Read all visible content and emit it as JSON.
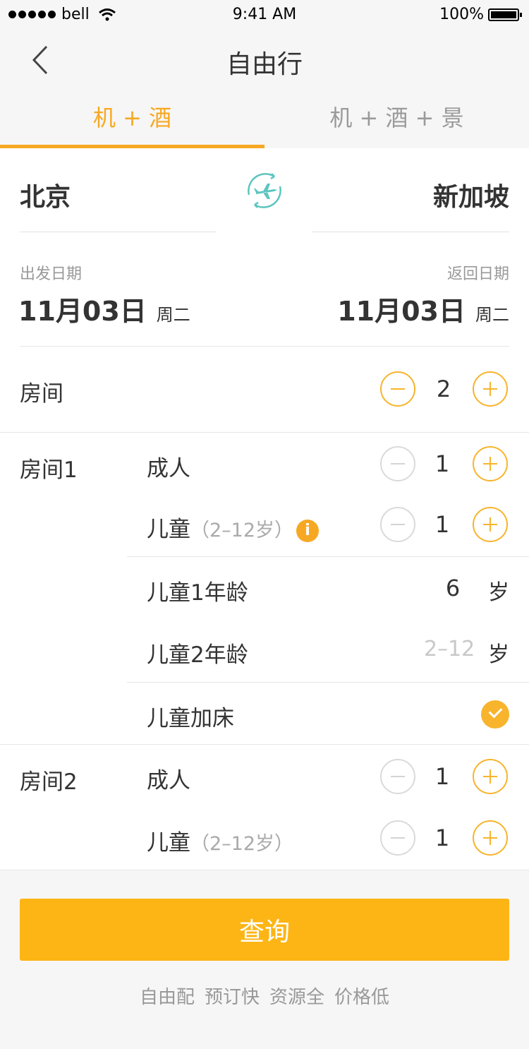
{
  "status": {
    "carrier": "bell",
    "time": "9:41 AM",
    "battery": "100%"
  },
  "nav": {
    "title": "自由行"
  },
  "tabs": [
    {
      "label": "机 + 酒",
      "active": true
    },
    {
      "label": "机 + 酒 + 景",
      "active": false
    }
  ],
  "trip": {
    "from_city": "北京",
    "to_city": "新加坡",
    "depart": {
      "label": "出发日期",
      "date": "11月03日",
      "weekday": "周二"
    },
    "return": {
      "label": "返回日期",
      "date": "11月03日",
      "weekday": "周二"
    }
  },
  "rooms": {
    "label": "房间",
    "count": "2",
    "room1": {
      "label": "房间1",
      "adult_label": "成人",
      "adult_count": "1",
      "child_label": "儿童",
      "child_range": "（2–12岁）",
      "child_count": "1",
      "child1_age_label": "儿童1年龄",
      "child1_age": "6",
      "age_unit": "岁",
      "child2_age_label": "儿童2年龄",
      "child2_age_placeholder": "2–12",
      "extra_bed_label": "儿童加床",
      "extra_bed_checked": true
    },
    "room2": {
      "label": "房间2",
      "adult_label": "成人",
      "adult_count": "1",
      "child_label": "儿童",
      "child_range": "（2–12岁）",
      "child_count": "1"
    }
  },
  "search": {
    "label": "查询"
  },
  "footer": {
    "tags": [
      "自由配",
      "预订快",
      "资源全",
      "价格低"
    ]
  },
  "colors": {
    "accent": "#f7a823",
    "button": "#fdb515",
    "plane_icon": "#5cc5c0"
  }
}
